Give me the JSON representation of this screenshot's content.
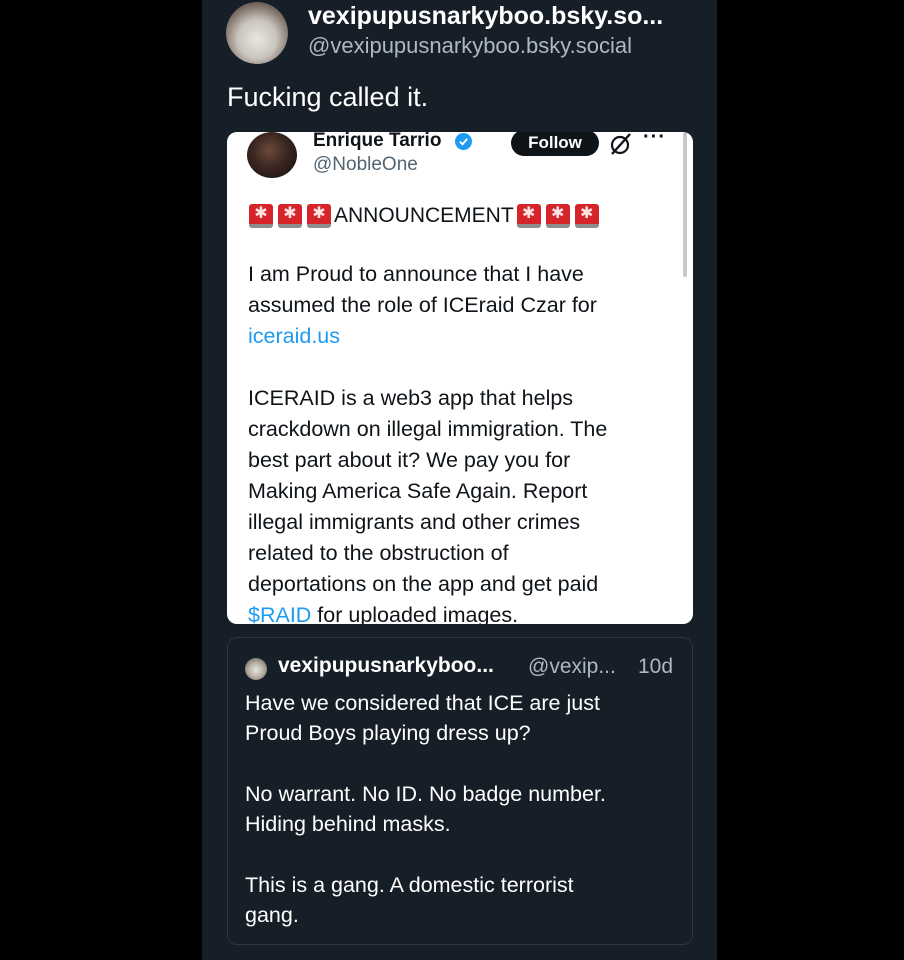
{
  "post": {
    "author_name": "vexipupusnarkyboo.bsky.so...",
    "author_handle": "@vexipupusnarkyboo.bsky.social",
    "text": "Fucking called it."
  },
  "embedded_tweet": {
    "name": "Enrique Tarrio",
    "handle": "@NobleOne",
    "follow_label": "Follow",
    "more_label": "···",
    "announcement": "ANNOUNCEMENT",
    "para1_line1": "I am Proud to announce that I have",
    "para1_line2": "assumed the role of ICEraid Czar for",
    "para1_link": "iceraid.us",
    "para2_lines": [
      "ICERAID is a web3 app that helps",
      "crackdown on illegal immigration. The",
      "best part about it? We pay you for",
      "Making America Safe Again. Report",
      "illegal immigrants and other crimes",
      "related to the obstruction of",
      "deportations on the app and get paid"
    ],
    "para2_last_link": "$RAID",
    "para2_last_rest": " for uploaded images."
  },
  "reply": {
    "name": "vexipupusnarkyboo...",
    "handle": "@vexip...",
    "time": "10d",
    "line1": "Have we considered that ICE are just",
    "line2": "Proud Boys playing dress up?",
    "line3": "No warrant. No ID. No badge number.",
    "line4": "Hiding behind masks.",
    "line5": "This is a gang. A domestic terrorist",
    "line6": "gang."
  },
  "colors": {
    "background": "#000000",
    "panel": "#161e27",
    "link": "#1d9bf0",
    "siren": "#d6242b"
  },
  "icons": [
    "avatar",
    "verified-badge-icon",
    "grok-icon",
    "more-icon",
    "siren-icon"
  ]
}
